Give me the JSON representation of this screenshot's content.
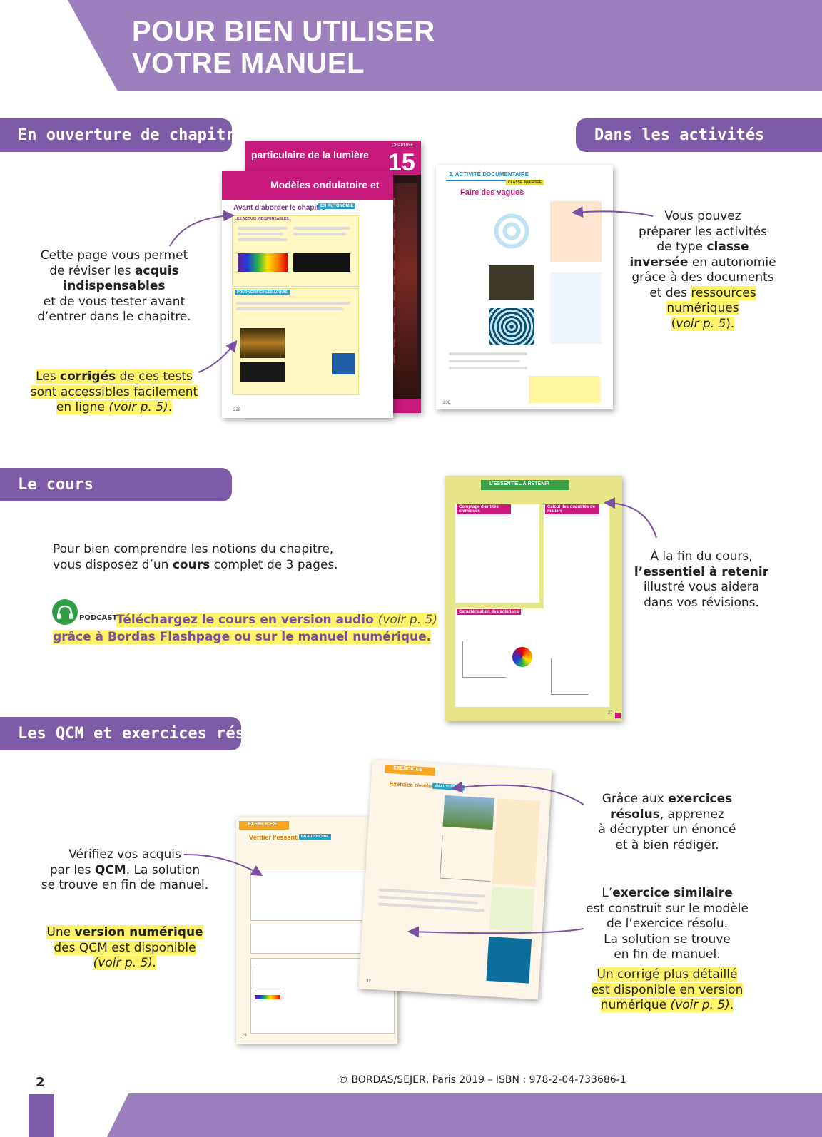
{
  "header": {
    "title_line1": "POUR BIEN UTILISER",
    "title_line2": "VOTRE MANUEL"
  },
  "sections": {
    "ouverture": "En ouverture de chapitre",
    "activites": "Dans les activités",
    "cours": "Le cours",
    "qcm": "Les QCM et exercices résolus"
  },
  "ouverture": {
    "p1_a": "Cette page vous permet",
    "p1_b": "de réviser les",
    "p1_c": "acquis",
    "p1_d": "indispensables",
    "p1_e": "et de vous tester avant",
    "p1_f": "d’entrer dans le chapitre.",
    "p2_a": "Les",
    "p2_b": "corrigés",
    "p2_c": "de ces tests",
    "p2_d": "sont accessibles facilement",
    "p2_e": "en ligne",
    "p2_f": "(voir p. 5)",
    "p2_g": ".",
    "thumb_back_title": "particulaire de la lumière",
    "thumb_chapter_label": "CHAPITRE",
    "thumb_chapter_num": "15",
    "thumb_front_title": "Modèles ondulatoire et",
    "thumb_avant": "Avant d’aborder le chapitre",
    "thumb_autonomie": "EN AUTONOMIE",
    "thumb_acquis": "LES ACQUIS INDISPENSABLES",
    "thumb_tester": "POUR VÉRIFIER LES ACQUIS",
    "thumb_page": "228"
  },
  "activites": {
    "p_a": "Vous pouvez",
    "p_b": "préparer les activités",
    "p_c": "de type",
    "p_d": "classe",
    "p_e": "inversée",
    "p_f": "en autonomie",
    "p_g": "grâce à des documents",
    "p_h": "et des",
    "p_i": "ressources",
    "p_j": "numériques",
    "p_k": "(",
    "p_l": "voir p. 5",
    "p_m": ").",
    "thumb_label": "3. ACTIVITÉ DOCUMENTAIRE",
    "thumb_classe": "CLASSE INVERSÉE",
    "thumb_title": "Faire des vagues",
    "thumb_page": "238"
  },
  "cours": {
    "p_a": "Pour bien comprendre les notions du chapitre,",
    "p_b": "vous disposez d’un",
    "p_c": "cours",
    "p_d": "complet de 3 pages.",
    "podcast_label": "PODCAST",
    "dl_a": "Téléchargez le cours en version audio",
    "dl_b": "(voir p. 5)",
    "dl_c": "grâce à Bordas Flashpage ou sur le manuel numérique.",
    "right_a": "À la fin du cours,",
    "right_b": "l’essentiel à retenir",
    "right_c": "illustré vous aidera",
    "right_d": "dans vos révisions.",
    "thumb_title": "L’ESSENTIEL À RETENIR",
    "thumb_box1": "Comptage d’entités chimiques",
    "thumb_box2": "Calcul des quantités de matière",
    "thumb_box3": "Caractérisation des solutions",
    "thumb_page": "27"
  },
  "qcm": {
    "left1_a": "Vérifiez vos acquis",
    "left1_b": "par les",
    "left1_c": "QCM",
    "left1_d": ". La solution",
    "left1_e": "se trouve en fin de manuel.",
    "left2_a": "Une",
    "left2_b": "version numérique",
    "left2_c": "des QCM est disponible",
    "left2_d": "(voir p. 5).",
    "right1_a": "Grâce aux",
    "right1_b": "exercices",
    "right1_c": "résolus",
    "right1_d": ", apprenez",
    "right1_e": "à décrypter un énoncé",
    "right1_f": "et à bien rédiger.",
    "right2_a": "L’",
    "right2_b": "exercice similaire",
    "right2_c": "est construit sur le modèle",
    "right2_d": "de l’exercice résolu.",
    "right2_e": "La solution se trouve",
    "right2_f": "en fin de manuel.",
    "right3_a": "Un corrigé plus détaillé",
    "right3_b": "est disponible en version",
    "right3_c": "numérique",
    "right3_d": "(voir p. 5)",
    "right3_e": ".",
    "thumb1_label": "EXERCICES",
    "thumb1_title": "Vérifier l’essentiel",
    "thumb1_autonomie": "EN AUTONOMIE",
    "thumb1_page": "28",
    "thumb2_label": "EXERCICES",
    "thumb2_title": "Exercice résolu",
    "thumb2_autonomie": "EN AUTONOMIE",
    "thumb2_page": "32"
  },
  "footer": {
    "page_number": "2",
    "copyright": "© BORDAS/SEJER, Paris 2019 – ISBN : 978-2-04-733686-1"
  },
  "colors": {
    "purple": "#9b80bd",
    "dark_purple": "#7d5ba6",
    "highlight": "#fff36a",
    "magenta": "#c8197d"
  }
}
